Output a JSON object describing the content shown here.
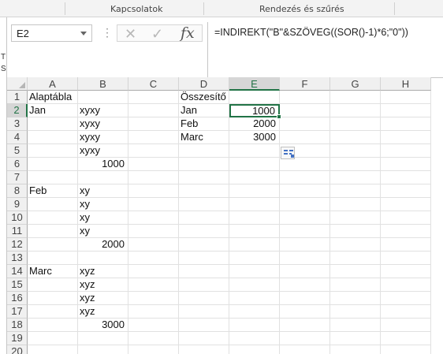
{
  "ribbon": {
    "groups": [
      "Kapcsolatok",
      "Rendezés és szűrés"
    ]
  },
  "left_edge": [
    "T",
    "S"
  ],
  "name_box": {
    "value": "E2"
  },
  "formula_bar": {
    "formula": "=INDIREKT(\"B\"&SZÖVEG((SOR()-1)*6;\"0\"))",
    "cancel_glyph": "✕",
    "enter_glyph": "✓",
    "fx_glyph": "fx",
    "dots_glyph": "⋮"
  },
  "columns": [
    "A",
    "B",
    "C",
    "D",
    "E",
    "F",
    "G",
    "H"
  ],
  "selected_column": "E",
  "selected_row": 2,
  "rows": [
    "1",
    "2",
    "3",
    "4",
    "5",
    "6",
    "7",
    "8",
    "9",
    "10",
    "11",
    "12",
    "13",
    "14",
    "15",
    "16",
    "17",
    "18",
    "19",
    "20"
  ],
  "cells": [
    {
      "ref": "A1",
      "v": "Alaptábla"
    },
    {
      "ref": "D1",
      "v": "Összesítő"
    },
    {
      "ref": "A2",
      "v": "Jan"
    },
    {
      "ref": "B2",
      "v": "xyxy"
    },
    {
      "ref": "D2",
      "v": "Jan"
    },
    {
      "ref": "E2",
      "v": "1000",
      "num": true
    },
    {
      "ref": "B3",
      "v": "xyxy"
    },
    {
      "ref": "D3",
      "v": "Feb"
    },
    {
      "ref": "E3",
      "v": "2000",
      "num": true
    },
    {
      "ref": "B4",
      "v": "xyxy"
    },
    {
      "ref": "D4",
      "v": "Marc"
    },
    {
      "ref": "E4",
      "v": "3000",
      "num": true
    },
    {
      "ref": "B5",
      "v": "xyxy"
    },
    {
      "ref": "B6",
      "v": "1000",
      "num": true
    },
    {
      "ref": "A8",
      "v": "Feb"
    },
    {
      "ref": "B8",
      "v": "xy"
    },
    {
      "ref": "B9",
      "v": "xy"
    },
    {
      "ref": "B10",
      "v": "xy"
    },
    {
      "ref": "B11",
      "v": "xy"
    },
    {
      "ref": "B12",
      "v": "2000",
      "num": true
    },
    {
      "ref": "A14",
      "v": "Marc"
    },
    {
      "ref": "B14",
      "v": "xyz"
    },
    {
      "ref": "B15",
      "v": "xyz"
    },
    {
      "ref": "B16",
      "v": "xyz"
    },
    {
      "ref": "B17",
      "v": "xyz"
    },
    {
      "ref": "B18",
      "v": "3000",
      "num": true
    }
  ],
  "active_cell": "E2",
  "colors": {
    "accent": "#217346",
    "quick_analysis": "#4472c4"
  }
}
